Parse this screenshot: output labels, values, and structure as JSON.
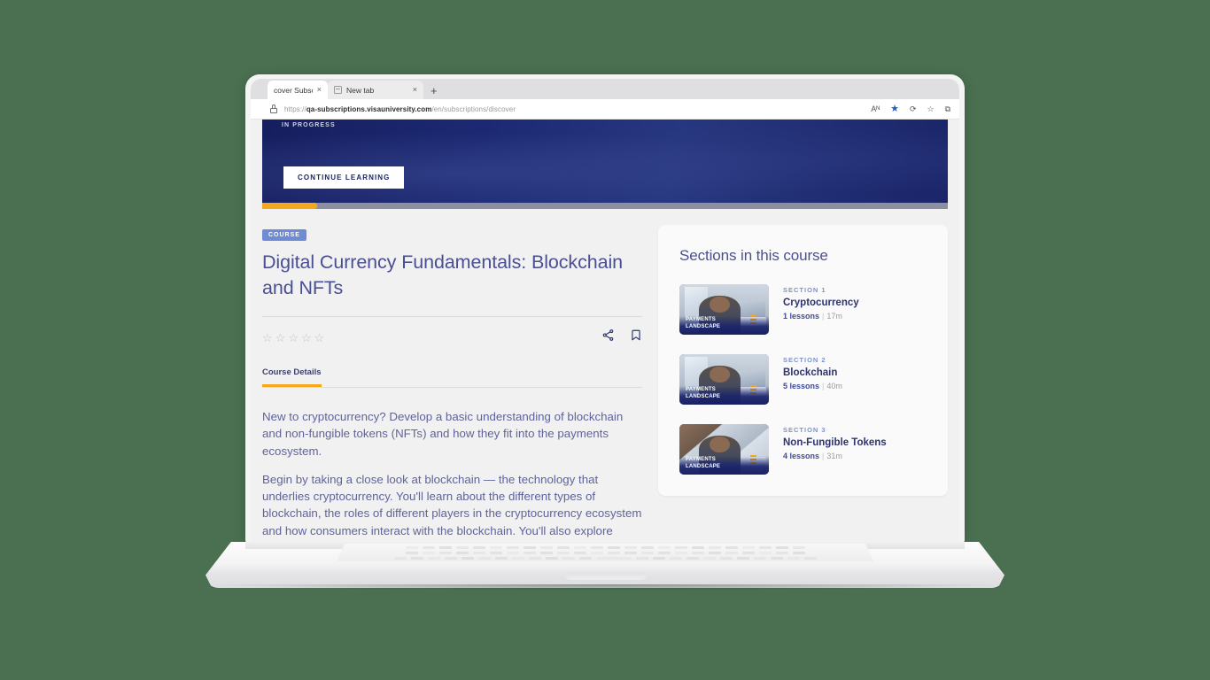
{
  "browser": {
    "tabs": [
      {
        "title": "cover Subscri",
        "close_label": "×",
        "active": true
      },
      {
        "title": "New tab",
        "close_label": "×",
        "active": false
      }
    ],
    "new_tab_label": "+",
    "url_prefix": "https://",
    "url_domain": "qa-subscriptions.visauniversity.com",
    "url_path": "/en/subscriptions/discover",
    "url_full": "https://qa-subscriptions.visauniversity.com/en/subscriptions/discover",
    "icons": {
      "read_aloud": "Aᴺ",
      "favorite_filled": "★",
      "refresh": "⟳",
      "add_favorite": "☆",
      "collections": "⧉"
    }
  },
  "hero": {
    "status": "IN PROGRESS",
    "cta_label": "CONTINUE LEARNING",
    "progress_percent": 8,
    "bar_color": "#f5a81c",
    "bar_track_color": "#8c8fa0"
  },
  "course": {
    "badge": "COURSE",
    "title": "Digital Currency Fundamentals: Blockchain and NFTs",
    "rating_stars": [
      "☆",
      "☆",
      "☆",
      "☆",
      "☆"
    ],
    "rating_value": 0,
    "share_icon": "share-icon",
    "bookmark_icon": "bookmark-icon",
    "tab_label": "Course Details",
    "accent_color": "#f5a81c",
    "title_color": "#4a4f94",
    "paragraphs": [
      "New to cryptocurrency? Develop a basic understanding of blockchain and non-fungible tokens (NFTs) and how they fit into the payments ecosystem.",
      "Begin by taking a close look at blockchain — the technology that underlies cryptocurrency. You'll learn about the different types of blockchain, the roles of different players in the cryptocurrency ecosystem and how consumers interact with the blockchain. You'll also explore several blockchain use cases"
    ]
  },
  "sections_panel": {
    "heading": "Sections in this course",
    "thumbnail_label_line1": "PAYMENTS",
    "thumbnail_label_line2": "LANDSCAPE",
    "lesson_separator": "|",
    "items": [
      {
        "label": "SECTION 1",
        "name": "Cryptocurrency",
        "lessons": "1 lessons",
        "duration": "17m"
      },
      {
        "label": "SECTION 2",
        "name": "Blockchain",
        "lessons": "5 lessons",
        "duration": "40m"
      },
      {
        "label": "SECTION 3",
        "name": "Non-Fungible Tokens",
        "lessons": "4 lessons",
        "duration": "31m"
      }
    ]
  },
  "scene": {
    "background_color": "#4a7051",
    "page_background": "#f1f1f2",
    "card_background": "#fafafa"
  }
}
